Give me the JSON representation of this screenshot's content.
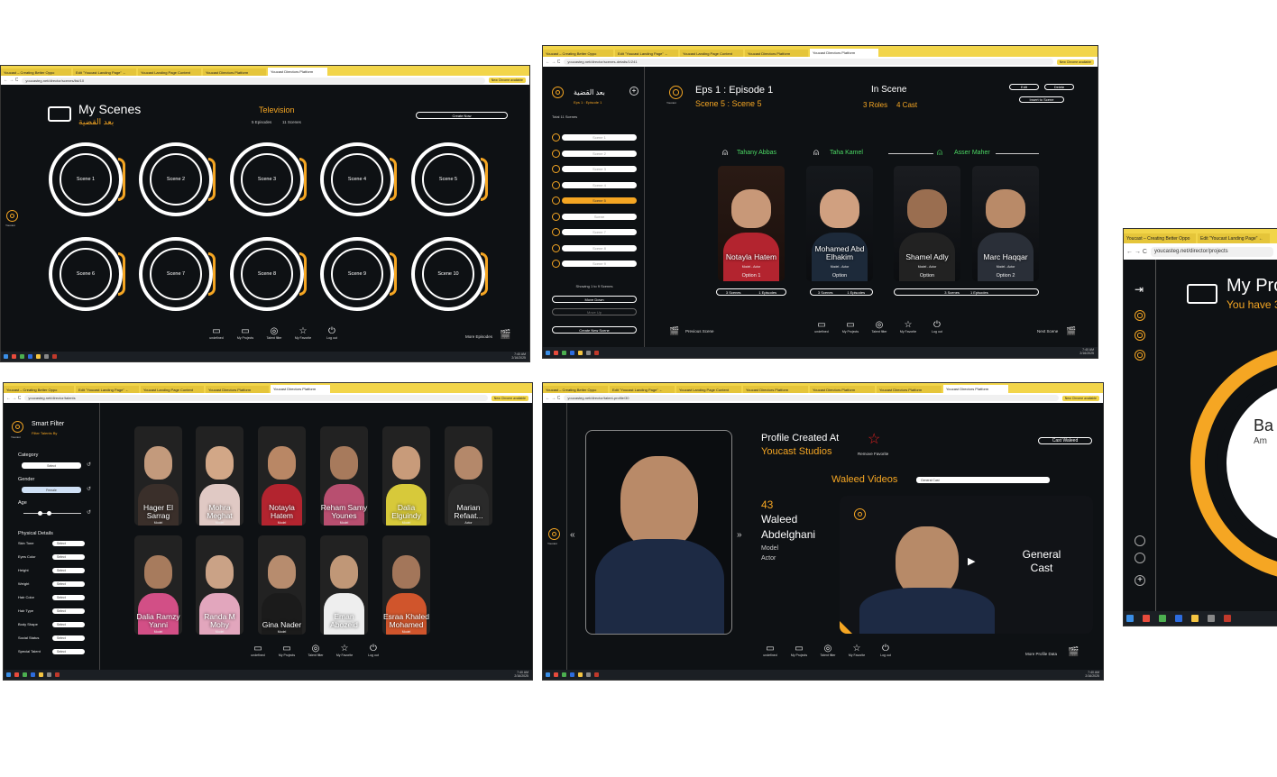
{
  "browser": {
    "tabs": [
      "Youcast – Creating Better Oppo",
      "Edit \"Youcast Landing Page\" ←",
      "Youcast Landing Page Content",
      "Youcast Directors Platform",
      "Youcast Directors Platform"
    ],
    "chrome_badge": "New Chrome available",
    "urls": {
      "scenes": "youcasteg.net/director/scenes/list/10",
      "scene_detail": "youcasteg.net/director/scenes-details/1/241",
      "talents": "youcasteg.net/director/talents",
      "profile": "youcasteg.net/director/talent-profile/30",
      "projects": "youcasteg.net/director/projects"
    },
    "taskbar_time": "7:40 AM",
    "taskbar_date": "2/16/2025",
    "taskbar_lang": "ENG"
  },
  "dock": [
    {
      "label": "undefined",
      "icon": "video-camera-icon"
    },
    {
      "label": "My Projects",
      "icon": "camera-icon"
    },
    {
      "label": "Talent filter",
      "icon": "target-icon"
    },
    {
      "label": "My Favorite",
      "icon": "star-icon"
    },
    {
      "label": "Log out",
      "icon": "power-icon"
    }
  ],
  "scenes_screen": {
    "title": "My Scenes",
    "subtitle_ar": "بعد القضية",
    "category": "Television",
    "episodes": "5 Episodes",
    "scenes_count": "11 Scenes",
    "create_button": "Create Now",
    "more_episodes": "More Episodes",
    "scenes": [
      "Scene 1",
      "Scene 2",
      "Scene 3",
      "Scene 4",
      "Scene 5",
      "Scene 6",
      "Scene 7",
      "Scene 8",
      "Scene 9",
      "Scene 10"
    ],
    "logo_caption": "Youcast"
  },
  "scene_detail_screen": {
    "sidebar_title_ar": "بعد القضية",
    "sidebar_sub": "Eps 1 : Episode 1",
    "total": "Total 11 Scenes",
    "list": [
      "Scene 1",
      "Scene 2",
      "Scene 3",
      "Scene 4",
      "Scene 5",
      "Scene",
      "Scene 7",
      "Scene 8",
      "Scene 9"
    ],
    "showing": "Showing 1 to 9 Scenes",
    "move_down": "Move Down",
    "move_up": "Move Up",
    "create_new": "Create New Scene",
    "heading": "Eps 1 : Episode 1",
    "subheading": "Scene 5 : Scene 5",
    "in_scene": "In Scene",
    "roles": "3 Roles",
    "cast": "4 Cast",
    "edit": "Edit",
    "delete": "Delete",
    "insert": "Insert to Scene",
    "roles_list": [
      {
        "name": "Tahany Abbas",
        "stats_scenes": "3 Scenes",
        "stats_eps": "1 Episodes"
      },
      {
        "name": "Taha Kamel",
        "stats_scenes": "3 Scenes",
        "stats_eps": "1 Episodes"
      },
      {
        "name": "Asser Maher",
        "stats_scenes": "3 Scenes",
        "stats_eps": "1 Episodes"
      }
    ],
    "actors": [
      {
        "name": "Notayla Hatem",
        "role": "Model - Actor",
        "option": "Option 1"
      },
      {
        "name": "Mohamed Abd Elhakim",
        "role": "Model - Actor",
        "option": "Option"
      },
      {
        "name": "Shamel Adly",
        "role": "Model - Actor",
        "option": "Option"
      },
      {
        "name": "Marc Haqqar",
        "role": "Model - Actor",
        "option": "Option 2"
      }
    ],
    "previous": "Previous Scene",
    "next": "Next Scene",
    "logo_caption": "Youcast"
  },
  "talents_screen": {
    "title": "Smart Filter",
    "subtitle": "Filter Talents By",
    "category_label": "Category",
    "category_value": "Select",
    "gender_label": "Gender",
    "gender_value": "Female",
    "age_label": "Age",
    "physical": "Physical Details",
    "fields": [
      "Skin Tone",
      "Eyes Color",
      "Height",
      "Weight",
      "Hair Color",
      "Hair Type",
      "Body Shape",
      "Social Status",
      "Special Talent"
    ],
    "field_value": "Select",
    "talents": [
      {
        "name": "Hager El Sarrag",
        "role": "Model"
      },
      {
        "name": "Mohra Meghat",
        "role": "Model"
      },
      {
        "name": "Notayla Hatem",
        "role": "Model"
      },
      {
        "name": "Reham Samy Younes",
        "role": "Model"
      },
      {
        "name": "Dalia Elguindy",
        "role": "Model"
      },
      {
        "name": "Marian Refaat...",
        "role": "Actor"
      },
      {
        "name": "Dalia Ramzy Yanni",
        "role": "Model"
      },
      {
        "name": "Randa M Mohy",
        "role": "Model"
      },
      {
        "name": "Gina Nader",
        "role": "Model"
      },
      {
        "name": "Eman Abozeid",
        "role": "Model"
      },
      {
        "name": "Esraa Khaled Mohamed",
        "role": "Model"
      }
    ],
    "logo_caption": "Youcast"
  },
  "profile_screen": {
    "created_at": "Profile Created At",
    "studio": "Youcast Studios",
    "remove_fav": "Remove Favorite",
    "cast_button": "Cast Waleed",
    "videos_label": "Waleed Videos",
    "videos_select": "General Cast",
    "age": "43",
    "first_name": "Waleed",
    "last_name": "Abdelghani",
    "role1": "Model",
    "role2": "Actor",
    "video_title": "General Cast",
    "more": "More Profile Data",
    "logo_caption": "Youcast"
  },
  "projects_screen": {
    "title": "My Pro",
    "subtitle": "You have 3",
    "card_text": "Ba",
    "card_sub": "Am"
  },
  "colors": {
    "accent": "#f5a623",
    "bg": "#0e1114",
    "green": "#4cd964"
  }
}
